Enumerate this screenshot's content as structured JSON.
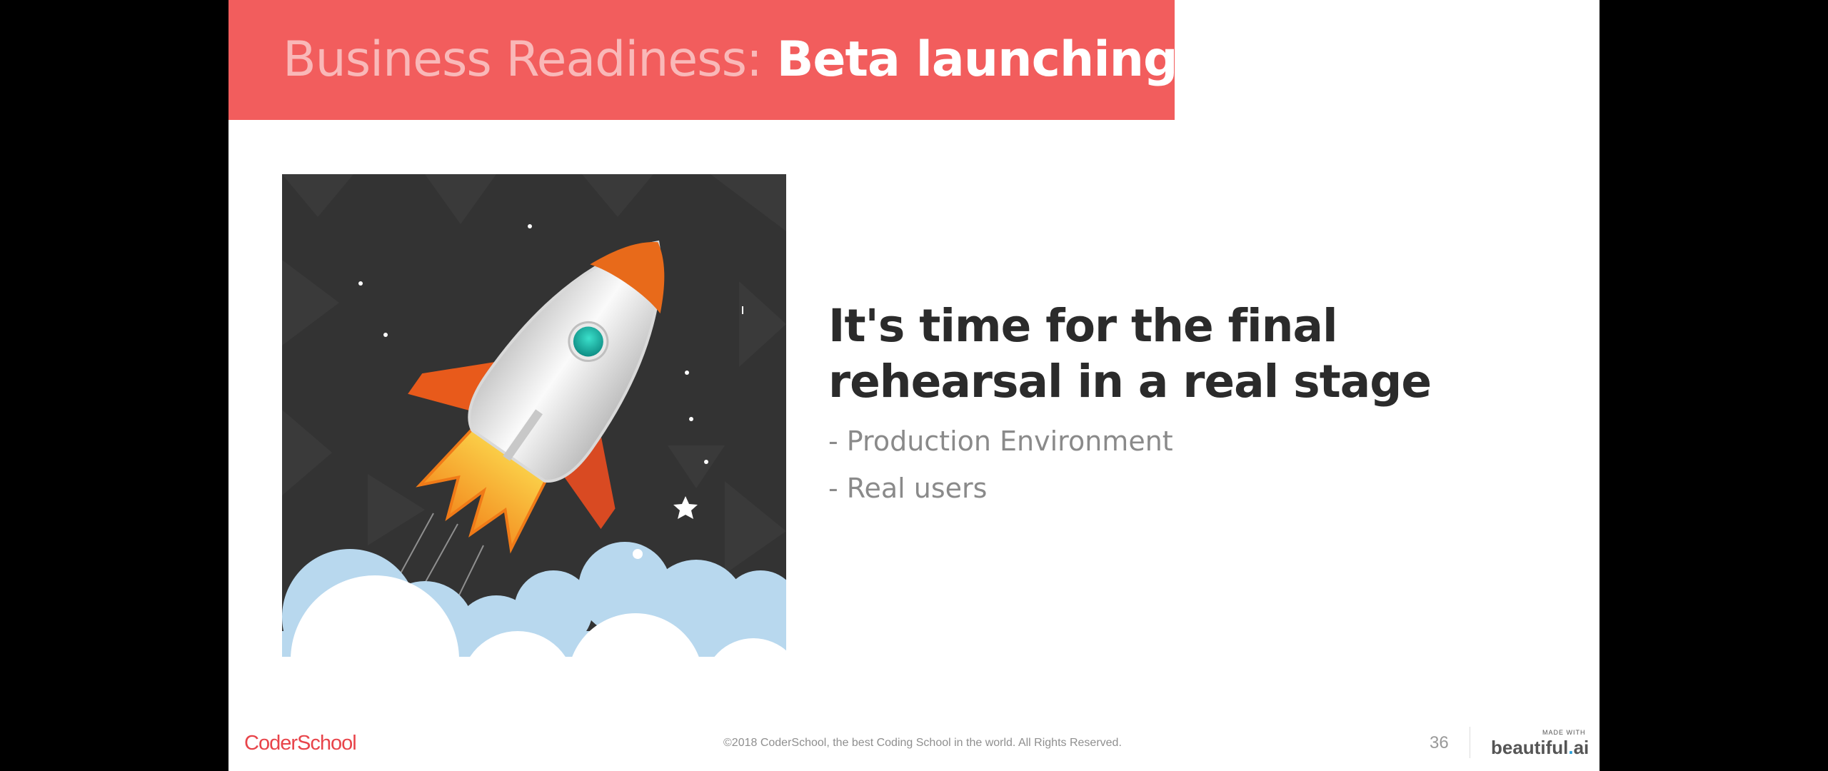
{
  "slide": {
    "title_prefix": "Business Readiness:",
    "title_main": "Beta launching",
    "headline": "It's time for the final rehearsal in a real stage",
    "bullets": [
      "- Production Environment",
      "- Real users"
    ],
    "illustration_icon": "rocket-launch-illustration"
  },
  "footer": {
    "logo": "CoderSchool",
    "copyright": "©2018 CoderSchool, the best Coding School in the world. All Rights Reserved.",
    "page_number": "36",
    "made_with": "MADE WITH",
    "brand_name": "beautiful",
    "brand_dot": ".",
    "brand_suffix": "ai"
  },
  "colors": {
    "accent": "#f25d5d",
    "title_prefix": "#f9b8b8",
    "headline": "#2b2b2b",
    "bullet_text": "#8a8a8a",
    "logo": "#e8444a"
  }
}
